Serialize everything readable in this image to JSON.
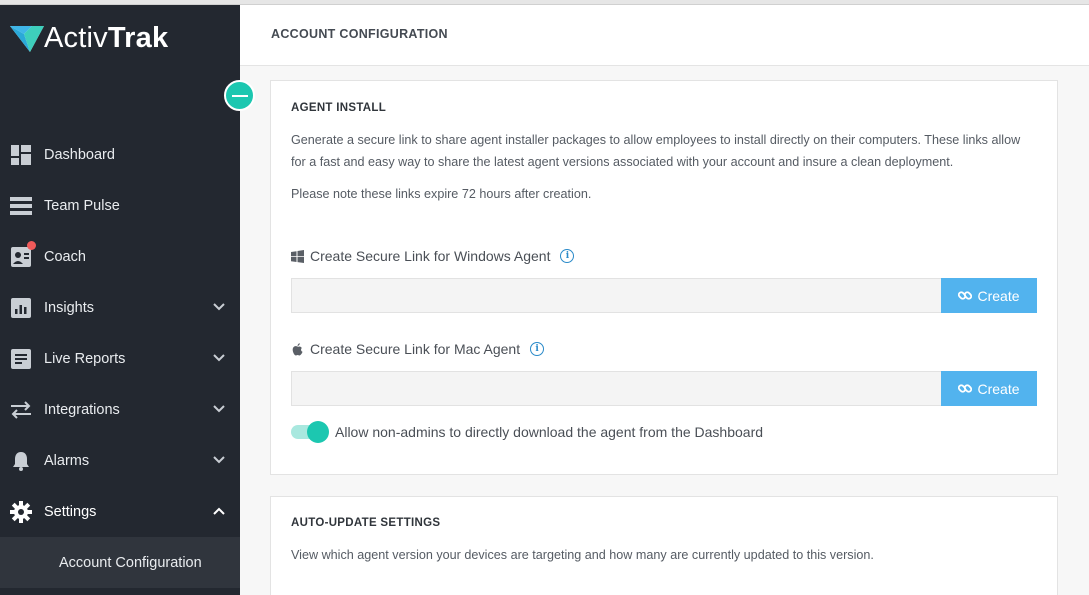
{
  "brand": {
    "logo_light": "Activ",
    "logo_bold": "Trak",
    "accent": "#1cc7b0"
  },
  "sidebar": {
    "items": [
      {
        "label": "Dashboard",
        "icon": "dashboard-icon",
        "expandable": false
      },
      {
        "label": "Team Pulse",
        "icon": "team-pulse-icon",
        "expandable": false
      },
      {
        "label": "Coach",
        "icon": "coach-icon",
        "expandable": false,
        "notification": true
      },
      {
        "label": "Insights",
        "icon": "insights-icon",
        "expandable": true
      },
      {
        "label": "Live Reports",
        "icon": "live-reports-icon",
        "expandable": true
      },
      {
        "label": "Integrations",
        "icon": "integrations-icon",
        "expandable": true
      },
      {
        "label": "Alarms",
        "icon": "bell-icon",
        "expandable": true
      },
      {
        "label": "Settings",
        "icon": "gear-icon",
        "expandable": true,
        "expanded": true
      }
    ],
    "subitems": [
      {
        "label": "Account Configuration",
        "active": true
      }
    ]
  },
  "header": {
    "title": "ACCOUNT CONFIGURATION"
  },
  "agent_install": {
    "title": "AGENT INSTALL",
    "description": "Generate a secure link to share agent installer packages to allow employees to install directly on their computers. These links allow for a fast and easy way to share the latest agent versions associated with your account and insure a clean deployment.",
    "note": "Please note these links expire 72 hours after creation.",
    "windows_label": "Create Secure Link for Windows Agent",
    "windows_value": "",
    "mac_label": "Create Secure Link for Mac Agent",
    "mac_value": "",
    "create_label": "Create",
    "toggle_label": "Allow non-admins to directly download the agent from the Dashboard",
    "toggle_on": true
  },
  "auto_update": {
    "title": "AUTO-UPDATE SETTINGS",
    "description": "View which agent version your devices are targeting and how many are currently updated to this version."
  }
}
